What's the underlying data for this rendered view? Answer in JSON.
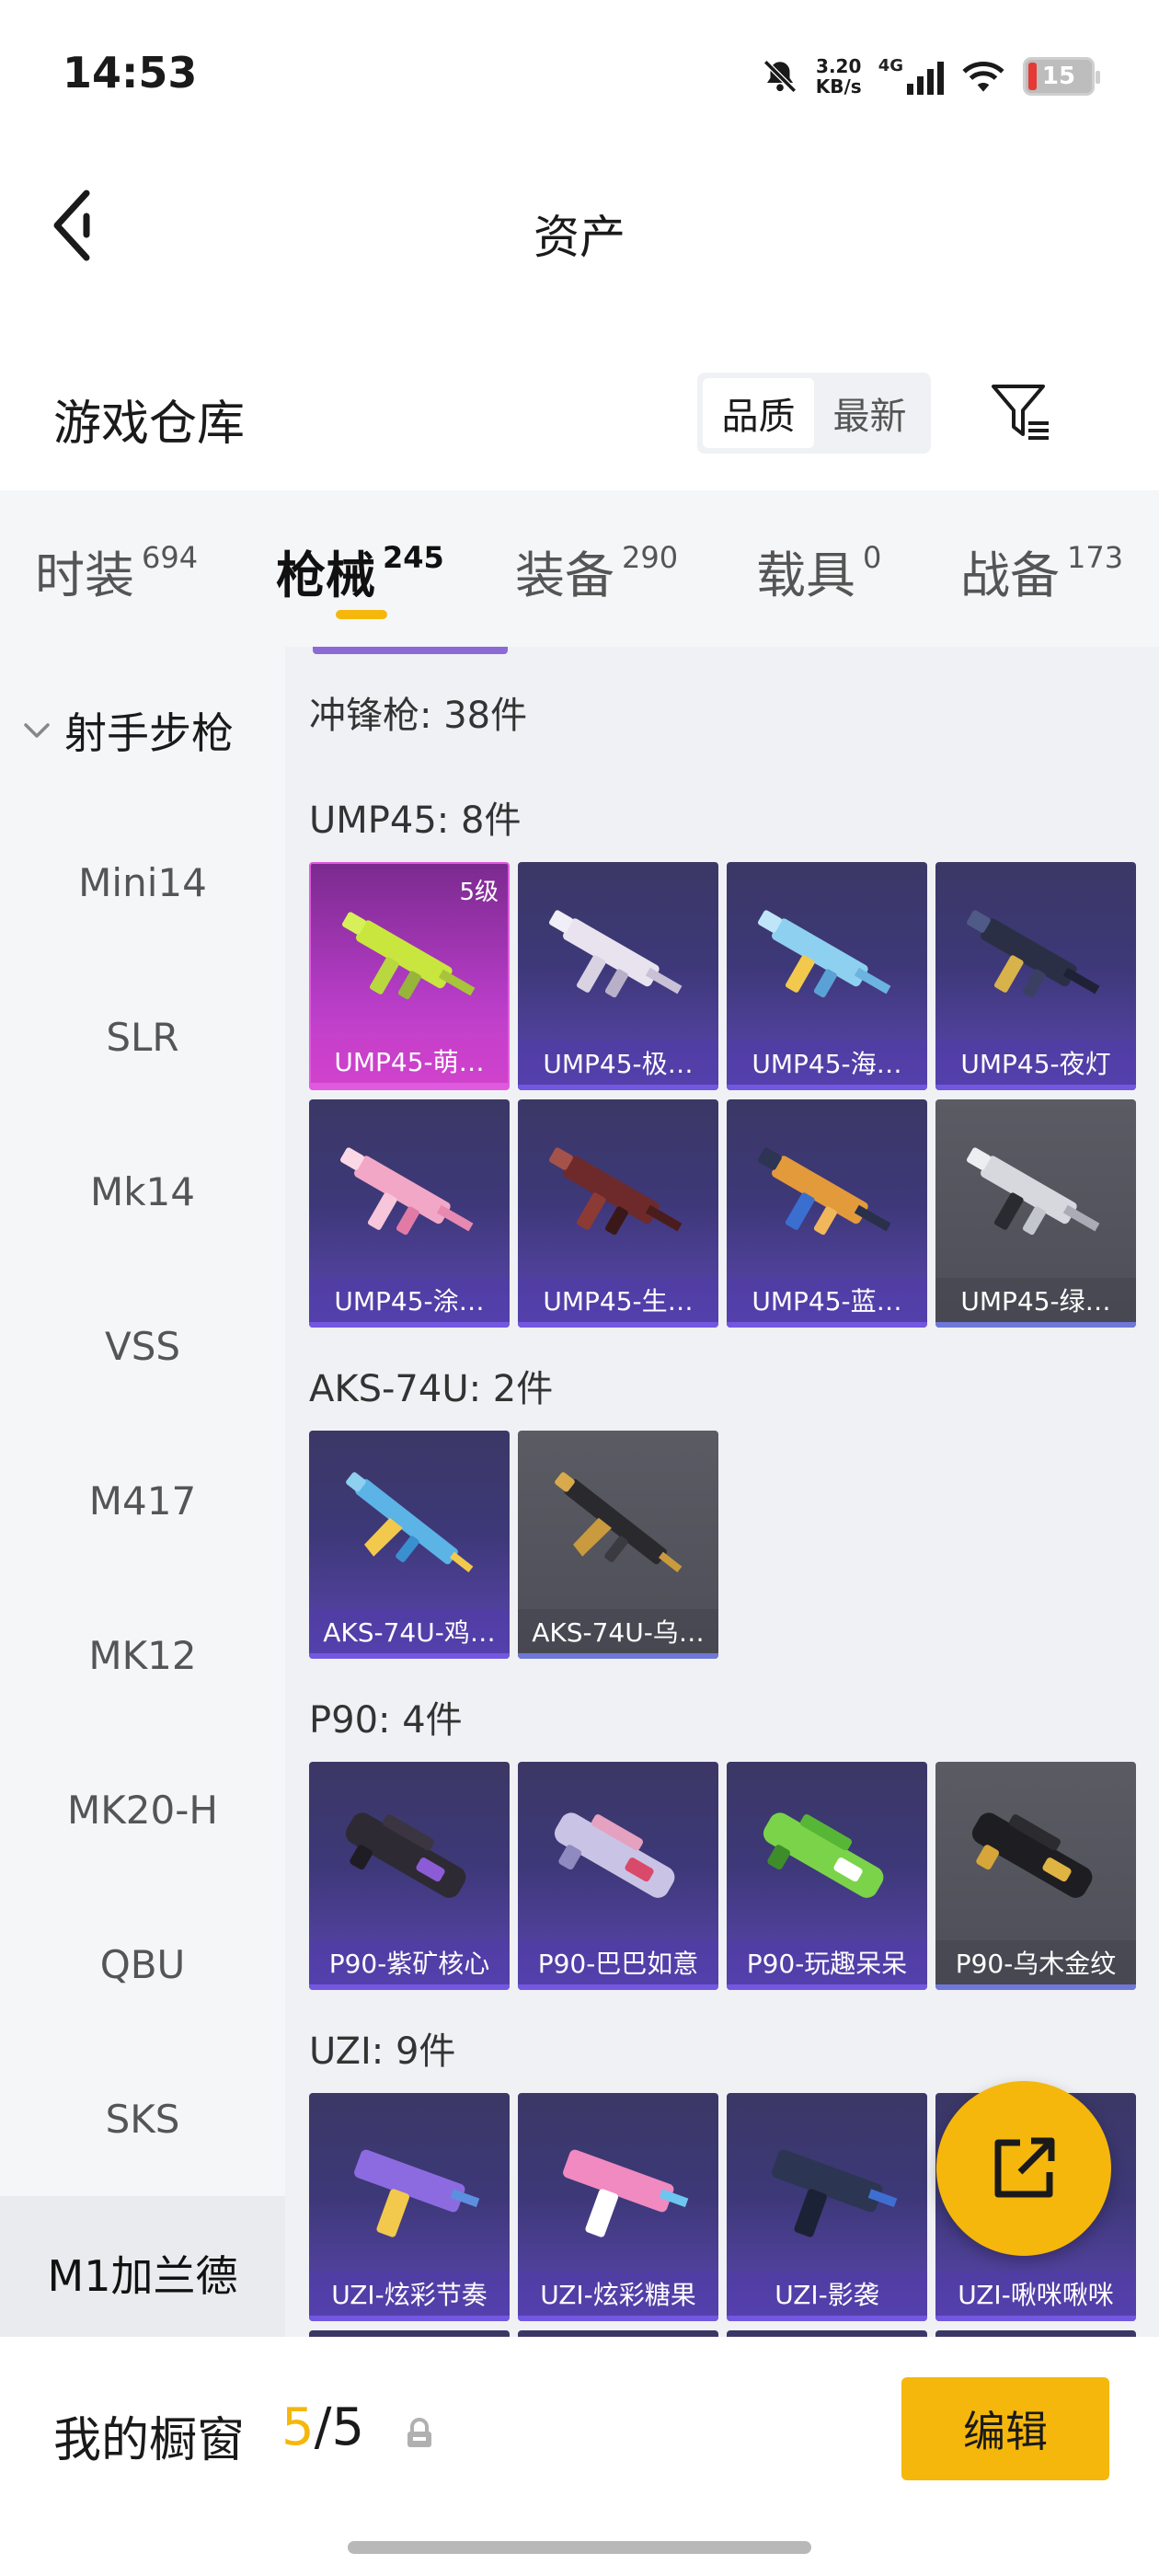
{
  "status": {
    "time": "14:53",
    "speed_top": "3.20",
    "speed_bottom": "KB/s",
    "network": "4G",
    "battery": "15"
  },
  "header": {
    "title": "资产"
  },
  "section": {
    "title": "游戏仓库",
    "sort_options": [
      "品质",
      "最新"
    ],
    "active_sort": "品质"
  },
  "tabs": [
    {
      "label": "时装",
      "count": "694"
    },
    {
      "label": "枪械",
      "count": "245"
    },
    {
      "label": "装备",
      "count": "290"
    },
    {
      "label": "载具",
      "count": "0"
    },
    {
      "label": "战备",
      "count": "173"
    }
  ],
  "sidebar": {
    "group": "射手步枪",
    "items": [
      "Mini14",
      "SLR",
      "Mk14",
      "VSS",
      "M417",
      "MK12",
      "MK20-H",
      "QBU",
      "SKS",
      "M1加兰德"
    ],
    "active_item": "M1加兰德"
  },
  "content": {
    "category_title": "冲锋枪: 38件",
    "groups": [
      {
        "title": "UMP45: 8件",
        "items": [
          {
            "name": "UMP45-萌…",
            "level": "5级",
            "style": "pink"
          },
          {
            "name": "UMP45-极…",
            "style": "purple"
          },
          {
            "name": "UMP45-海…",
            "style": "purple"
          },
          {
            "name": "UMP45-夜灯",
            "style": "purple"
          },
          {
            "name": "UMP45-涂…",
            "style": "purple"
          },
          {
            "name": "UMP45-生…",
            "style": "purple"
          },
          {
            "name": "UMP45-蓝…",
            "style": "purple"
          },
          {
            "name": "UMP45-绿…",
            "style": "gray"
          }
        ]
      },
      {
        "title": "AKS-74U: 2件",
        "items": [
          {
            "name": "AKS-74U-鸡…",
            "style": "purple"
          },
          {
            "name": "AKS-74U-乌…",
            "style": "gray"
          }
        ]
      },
      {
        "title": "P90: 4件",
        "items": [
          {
            "name": "P90-紫矿核心",
            "style": "purple"
          },
          {
            "name": "P90-巴巴如意",
            "style": "purple"
          },
          {
            "name": "P90-玩趣呆呆",
            "style": "purple"
          },
          {
            "name": "P90-乌木金纹",
            "style": "gray"
          }
        ]
      },
      {
        "title": "UZI: 9件",
        "items": [
          {
            "name": "UZI-炫彩节奏",
            "style": "purple"
          },
          {
            "name": "UZI-炫彩糖果",
            "style": "purple"
          },
          {
            "name": "UZI-影袭",
            "style": "purple"
          },
          {
            "name": "UZI-啾咪啾咪",
            "style": "purple"
          }
        ]
      }
    ]
  },
  "showcase": {
    "label": "我的橱窗",
    "current": "5",
    "separator": "/",
    "total": "5",
    "edit_label": "编辑"
  },
  "colors": {
    "accent": "#f5b70c",
    "card_purple": "#3d3878",
    "card_gray": "#4d4e57",
    "card_pink": "#b63cc6"
  },
  "icons": {
    "back": "chevron-left-icon",
    "filter": "filter-icon",
    "share": "external-link-icon",
    "lock": "lock-icon"
  }
}
